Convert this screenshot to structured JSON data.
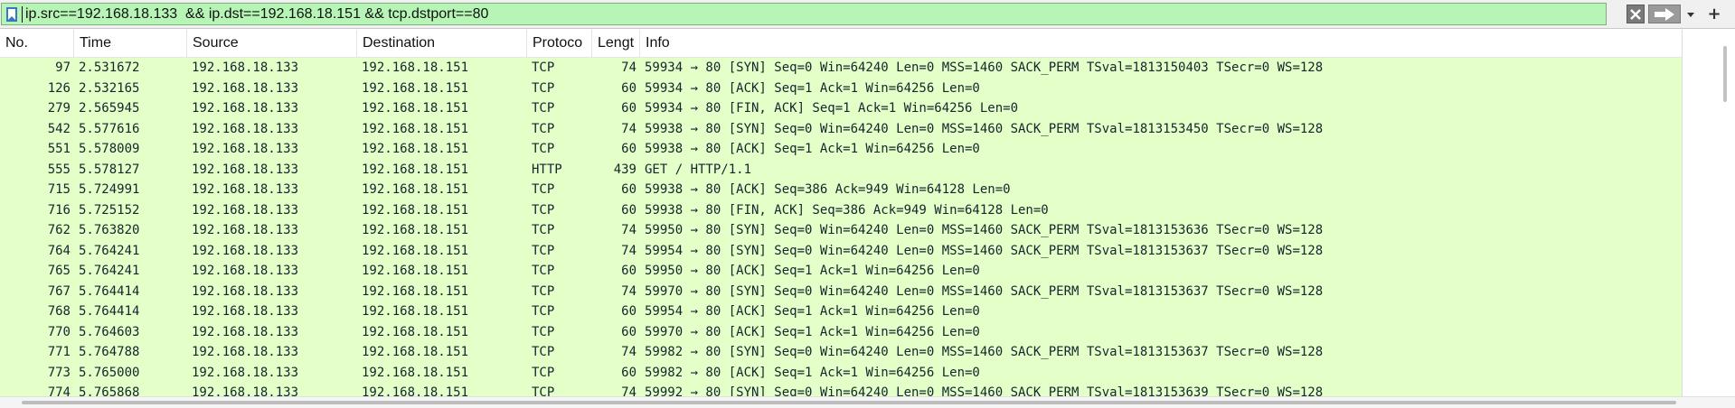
{
  "filter": {
    "value": "ip.src==192.168.18.133  && ip.dst==192.168.18.151 && tcp.dstport==80",
    "bookmark_icon": "bookmark-icon",
    "clear_icon": "clear-x-icon",
    "apply_icon": "arrow-right-icon",
    "dropdown_icon": "chevron-down-icon",
    "add_label": "+",
    "field_color": "#b6f5b5"
  },
  "packet_list": {
    "columns": [
      "No.",
      "Time",
      "Source",
      "Destination",
      "Protoco",
      "Lengt",
      "Info"
    ],
    "row_color": "#e4ffc7",
    "rows": [
      {
        "no": "97",
        "time": "2.531672",
        "src": "192.168.18.133",
        "dst": "192.168.18.151",
        "proto": "TCP",
        "len": "74",
        "info": "59934 → 80 [SYN] Seq=0 Win=64240 Len=0 MSS=1460 SACK_PERM TSval=1813150403 TSecr=0 WS=128"
      },
      {
        "no": "126",
        "time": "2.532165",
        "src": "192.168.18.133",
        "dst": "192.168.18.151",
        "proto": "TCP",
        "len": "60",
        "info": "59934 → 80 [ACK] Seq=1 Ack=1 Win=64256 Len=0"
      },
      {
        "no": "279",
        "time": "2.565945",
        "src": "192.168.18.133",
        "dst": "192.168.18.151",
        "proto": "TCP",
        "len": "60",
        "info": "59934 → 80 [FIN, ACK] Seq=1 Ack=1 Win=64256 Len=0"
      },
      {
        "no": "542",
        "time": "5.577616",
        "src": "192.168.18.133",
        "dst": "192.168.18.151",
        "proto": "TCP",
        "len": "74",
        "info": "59938 → 80 [SYN] Seq=0 Win=64240 Len=0 MSS=1460 SACK_PERM TSval=1813153450 TSecr=0 WS=128"
      },
      {
        "no": "551",
        "time": "5.578009",
        "src": "192.168.18.133",
        "dst": "192.168.18.151",
        "proto": "TCP",
        "len": "60",
        "info": "59938 → 80 [ACK] Seq=1 Ack=1 Win=64256 Len=0"
      },
      {
        "no": "555",
        "time": "5.578127",
        "src": "192.168.18.133",
        "dst": "192.168.18.151",
        "proto": "HTTP",
        "len": "439",
        "info": "GET / HTTP/1.1"
      },
      {
        "no": "715",
        "time": "5.724991",
        "src": "192.168.18.133",
        "dst": "192.168.18.151",
        "proto": "TCP",
        "len": "60",
        "info": "59938 → 80 [ACK] Seq=386 Ack=949 Win=64128 Len=0"
      },
      {
        "no": "716",
        "time": "5.725152",
        "src": "192.168.18.133",
        "dst": "192.168.18.151",
        "proto": "TCP",
        "len": "60",
        "info": "59938 → 80 [FIN, ACK] Seq=386 Ack=949 Win=64128 Len=0"
      },
      {
        "no": "762",
        "time": "5.763820",
        "src": "192.168.18.133",
        "dst": "192.168.18.151",
        "proto": "TCP",
        "len": "74",
        "info": "59950 → 80 [SYN] Seq=0 Win=64240 Len=0 MSS=1460 SACK_PERM TSval=1813153636 TSecr=0 WS=128"
      },
      {
        "no": "764",
        "time": "5.764241",
        "src": "192.168.18.133",
        "dst": "192.168.18.151",
        "proto": "TCP",
        "len": "74",
        "info": "59954 → 80 [SYN] Seq=0 Win=64240 Len=0 MSS=1460 SACK_PERM TSval=1813153637 TSecr=0 WS=128"
      },
      {
        "no": "765",
        "time": "5.764241",
        "src": "192.168.18.133",
        "dst": "192.168.18.151",
        "proto": "TCP",
        "len": "60",
        "info": "59950 → 80 [ACK] Seq=1 Ack=1 Win=64256 Len=0"
      },
      {
        "no": "767",
        "time": "5.764414",
        "src": "192.168.18.133",
        "dst": "192.168.18.151",
        "proto": "TCP",
        "len": "74",
        "info": "59970 → 80 [SYN] Seq=0 Win=64240 Len=0 MSS=1460 SACK_PERM TSval=1813153637 TSecr=0 WS=128"
      },
      {
        "no": "768",
        "time": "5.764414",
        "src": "192.168.18.133",
        "dst": "192.168.18.151",
        "proto": "TCP",
        "len": "60",
        "info": "59954 → 80 [ACK] Seq=1 Ack=1 Win=64256 Len=0"
      },
      {
        "no": "770",
        "time": "5.764603",
        "src": "192.168.18.133",
        "dst": "192.168.18.151",
        "proto": "TCP",
        "len": "60",
        "info": "59970 → 80 [ACK] Seq=1 Ack=1 Win=64256 Len=0"
      },
      {
        "no": "771",
        "time": "5.764788",
        "src": "192.168.18.133",
        "dst": "192.168.18.151",
        "proto": "TCP",
        "len": "74",
        "info": "59982 → 80 [SYN] Seq=0 Win=64240 Len=0 MSS=1460 SACK_PERM TSval=1813153637 TSecr=0 WS=128"
      },
      {
        "no": "773",
        "time": "5.765000",
        "src": "192.168.18.133",
        "dst": "192.168.18.151",
        "proto": "TCP",
        "len": "60",
        "info": "59982 → 80 [ACK] Seq=1 Ack=1 Win=64256 Len=0"
      },
      {
        "no": "774",
        "time": "5.765868",
        "src": "192.168.18.133",
        "dst": "192.168.18.151",
        "proto": "TCP",
        "len": "74",
        "info": "59992 → 80 [SYN] Seq=0 Win=64240 Len=0 MSS=1460 SACK_PERM TSval=1813153639 TSecr=0 WS=128"
      }
    ]
  }
}
